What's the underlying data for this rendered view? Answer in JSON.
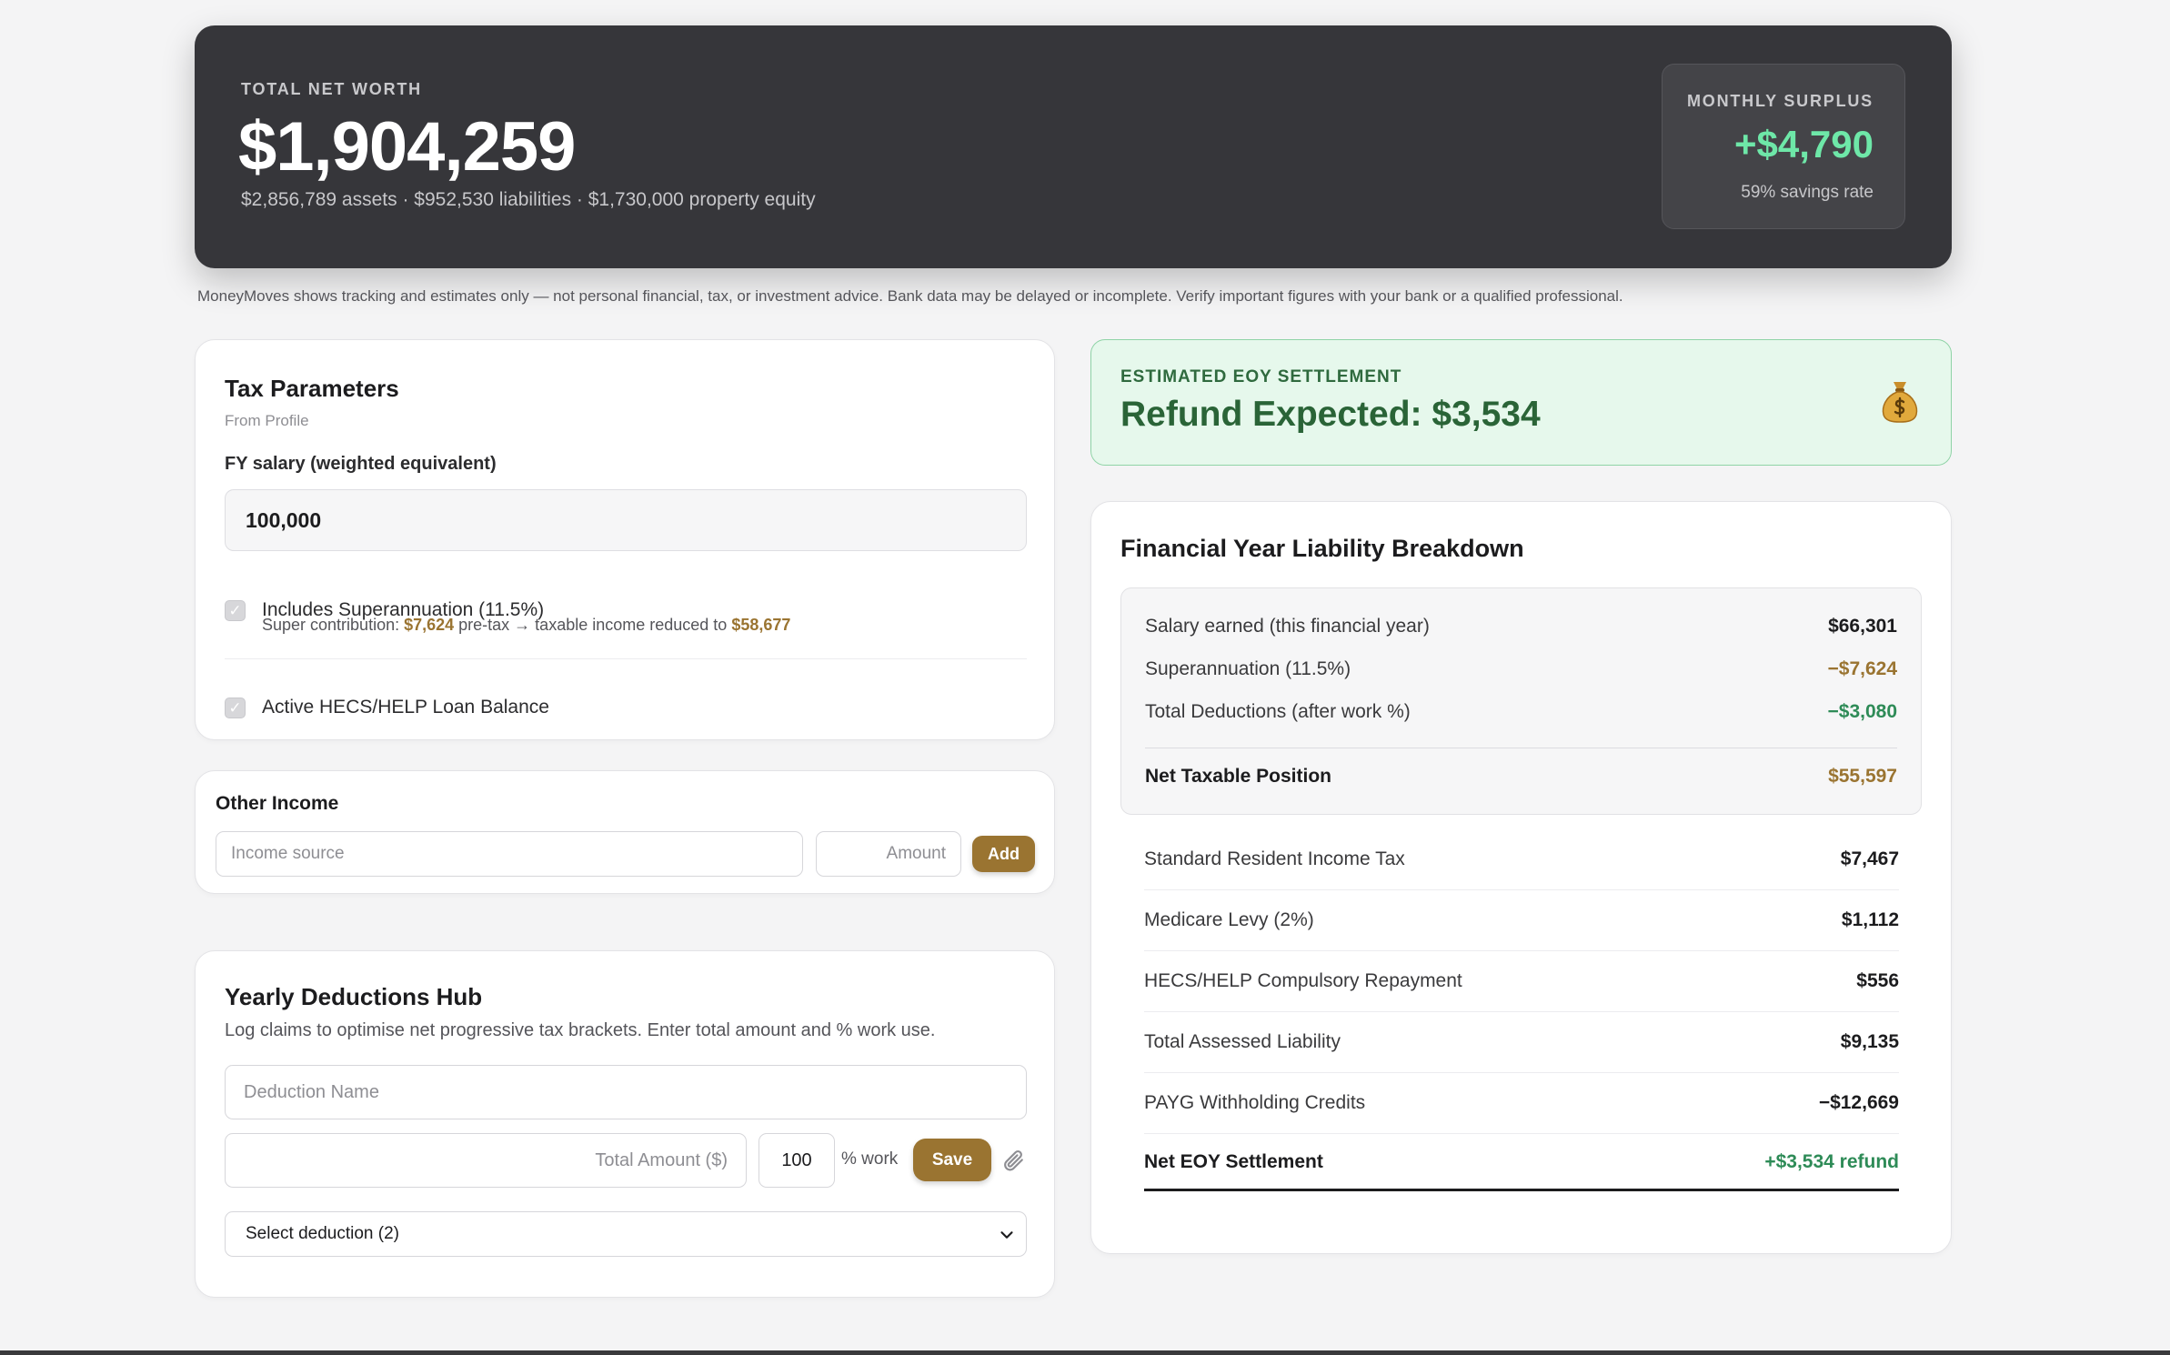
{
  "hero": {
    "eyebrow": "TOTAL NET WORTH",
    "net_worth": "$1,904,259",
    "breakdown": "$2,856,789 assets · $952,530 liabilities · $1,730,000 property equity",
    "surplus": {
      "label": "MONTHLY SURPLUS",
      "value": "+$4,790",
      "rate": "59% savings rate"
    }
  },
  "disclaimer": "MoneyMoves shows tracking and estimates only — not personal financial, tax, or investment advice. Bank data may be delayed or incomplete. Verify important figures with your bank or a qualified professional.",
  "tax_params": {
    "title": "Tax Parameters",
    "source": "From Profile",
    "salary_label": "FY salary (weighted equivalent)",
    "salary_value": "100,000",
    "super_label": "Includes Superannuation (11.5%)",
    "super_note_prefix": "Super contribution: ",
    "super_amount": "$7,624",
    "super_note_mid": " pre-tax → taxable income reduced to ",
    "taxable_income": "$58,677",
    "hecs_label": "Active HECS/HELP Loan Balance",
    "check_glyph": "✓"
  },
  "other_income": {
    "title": "Other Income",
    "source_placeholder": "Income source",
    "amount_placeholder": "Amount",
    "add_label": "Add"
  },
  "deductions": {
    "title": "Yearly Deductions Hub",
    "description": "Log claims to optimise net progressive tax brackets. Enter total amount and % work use.",
    "name_placeholder": "Deduction Name",
    "amount_placeholder": "Total Amount ($)",
    "work_pct": "100",
    "work_label": "% work",
    "save_label": "Save",
    "select_value": "Select deduction (2)"
  },
  "settlement": {
    "eyebrow": "ESTIMATED EOY SETTLEMENT",
    "headline": "Refund Expected: $3,534"
  },
  "liability": {
    "title": "Financial Year Liability Breakdown",
    "summary": [
      {
        "label": "Salary earned (this financial year)",
        "value": "$66,301"
      },
      {
        "label": "Superannuation (11.5%)",
        "value": "−$7,624"
      },
      {
        "label": "Total Deductions (after work %)",
        "value": "−$3,080"
      }
    ],
    "net_taxable": {
      "label": "Net Taxable Position",
      "value": "$55,597"
    },
    "rows": [
      {
        "label": "Standard Resident Income Tax",
        "value": "$7,467"
      },
      {
        "label": "Medicare Levy (2%)",
        "value": "$1,112"
      },
      {
        "label": "HECS/HELP Compulsory Repayment",
        "value": "$556"
      },
      {
        "label": "Total Assessed Liability",
        "value": "$9,135"
      },
      {
        "label": "PAYG Withholding Credits",
        "value": "−$12,669"
      }
    ],
    "net_eoy": {
      "label": "Net EOY Settlement",
      "value": "+$3,534 refund"
    }
  },
  "colors": {
    "accent_gold": "#9a7431",
    "positive_green": "#2e8b57",
    "negative_red": "#d03a3a",
    "hero_bg": "#36363a",
    "refund_bg": "#e6f8ec"
  }
}
